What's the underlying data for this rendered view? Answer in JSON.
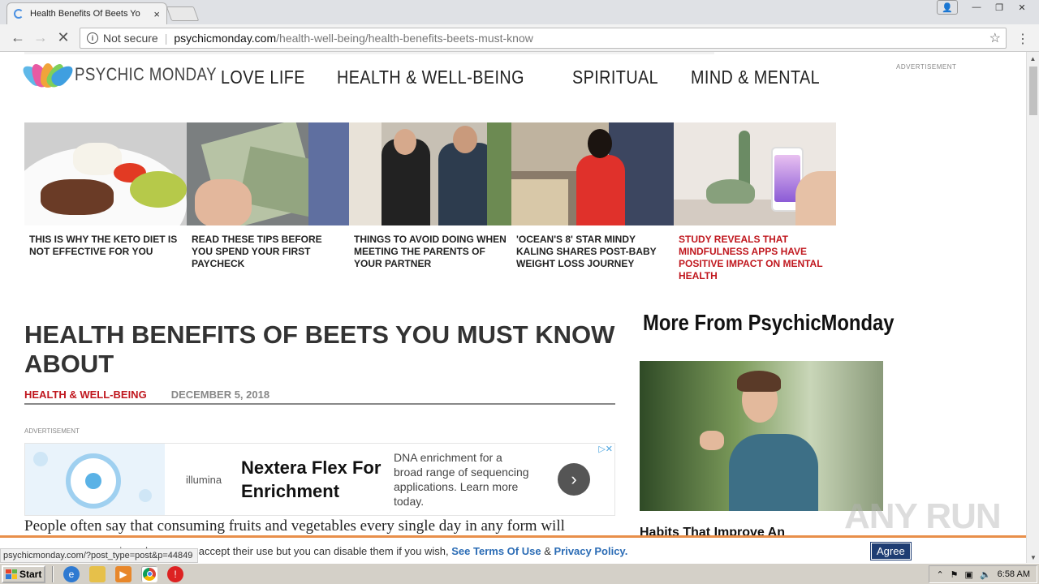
{
  "browser": {
    "tab_title": "Health Benefits Of Beets Yo",
    "tab_close": "×",
    "omnibox": {
      "security": "Not secure",
      "domain": "psychicmonday.com",
      "path": "/health-well-being/health-benefits-beets-must-know"
    },
    "nav": {
      "back": "←",
      "forward": "→",
      "reload": "✕",
      "star": "☆",
      "menu": "⋮"
    },
    "window": {
      "user": "👤",
      "minimize": "—",
      "restore": "❐",
      "close": "✕"
    }
  },
  "site": {
    "logo_text": "PSYCHIC MONDAY",
    "nav": [
      "LOVE LIFE",
      "HEALTH & WELL-BEING",
      "SPIRITUAL",
      "MIND & MENTAL"
    ],
    "ad_label_top": "ADVERTISEMENT"
  },
  "cards": [
    {
      "title": "THIS IS WHY THE KETO DIET IS NOT EFFECTIVE FOR YOU",
      "highlight": false
    },
    {
      "title": "READ THESE TIPS BEFORE YOU SPEND YOUR FIRST PAYCHECK",
      "highlight": false
    },
    {
      "title": "THINGS TO AVOID DOING WHEN MEETING THE PARENTS OF YOUR PARTNER",
      "highlight": false
    },
    {
      "title": "'OCEAN'S 8' STAR MINDY KALING SHARES POST-BABY WEIGHT LOSS JOURNEY",
      "highlight": false
    },
    {
      "title": "STUDY REVEALS THAT MINDFULNESS APPS HAVE POSITIVE IMPACT ON MENTAL HEALTH",
      "highlight": true
    }
  ],
  "article": {
    "title": "HEALTH BENEFITS OF BEETS YOU MUST KNOW ABOUT",
    "category": "HEALTH & WELL-BEING",
    "date": "DECEMBER 5, 2018",
    "ad_label": "ADVERTISEMENT",
    "body_first_line": "People often say that consuming fruits and vegetables every single day in any form will"
  },
  "ad": {
    "brand": "illumina",
    "headline": "Nextera Flex For Enrichment",
    "description": "DNA enrichment for a broad range of sequencing applications. Learn more today.",
    "arrow": "›",
    "adchoices": "▷✕"
  },
  "sidebar": {
    "title": "More From PsychicMonday",
    "caption": "Habits That Improve An"
  },
  "cookie": {
    "text_visible": "nize ads. you can accept their use but you can disable them if you wish,",
    "terms_link": "See Terms Of Use",
    "and": "&",
    "privacy_link": "Privacy Policy.",
    "agree": "Agree"
  },
  "status_url": "psychicmonday.com/?post_type=post&p=44849",
  "watermark": "ANY RUN",
  "taskbar": {
    "start": "Start",
    "time": "6:58 AM"
  }
}
